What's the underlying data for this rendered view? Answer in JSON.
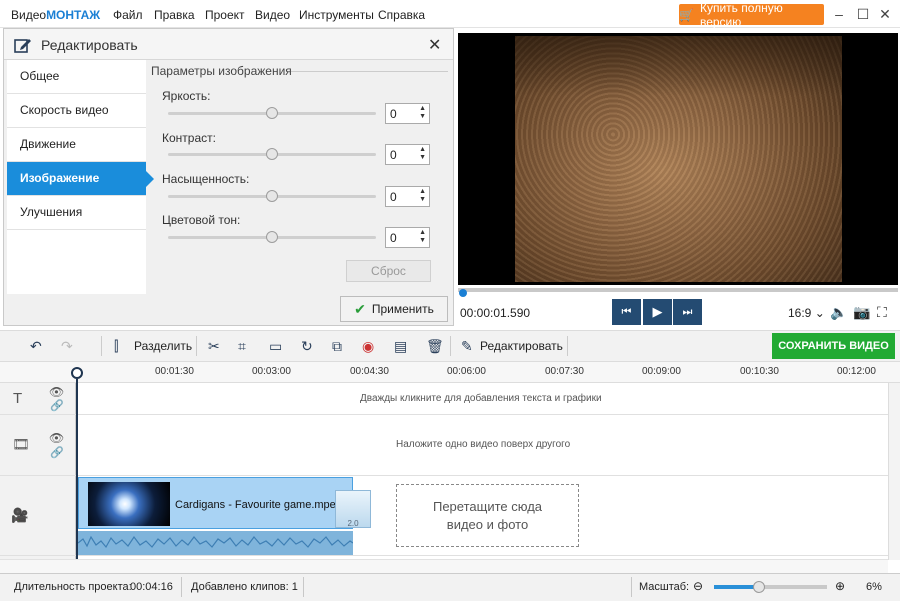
{
  "app": {
    "title_prefix": "Видео",
    "title_brand": "МОНТАЖ"
  },
  "menu": [
    "Файл",
    "Правка",
    "Проект",
    "Видео",
    "Инструменты",
    "Справка"
  ],
  "buy_button": "Купить полную версию",
  "window_controls": {
    "minimize": "–",
    "maximize": "☐",
    "close": "✕"
  },
  "edit_panel": {
    "title": "Редактировать",
    "nav": [
      "Общее",
      "Скорость видео",
      "Движение",
      "Изображение",
      "Улучшения"
    ],
    "active_nav": "Изображение",
    "params_title": "Параметры изображения",
    "params": [
      {
        "label": "Яркость:",
        "value": "0",
        "level": 0.5
      },
      {
        "label": "Контраст:",
        "value": "0",
        "level": 0.5
      },
      {
        "label": "Насыщенность:",
        "value": "0",
        "level": 0.5
      },
      {
        "label": "Цветовой тон:",
        "value": "0",
        "level": 0.5
      }
    ],
    "reset": "Сброс",
    "apply": "Применить"
  },
  "preview": {
    "timecode": "00:00:01.590",
    "aspect_ratio": "16:9 ⌄"
  },
  "toolbar": {
    "split": "Разделить",
    "edit": "Редактировать",
    "save": "СОХРАНИТЬ ВИДЕО"
  },
  "ruler": [
    "00:01:30",
    "00:03:00",
    "00:04:30",
    "00:06:00",
    "00:07:30",
    "00:09:00",
    "00:10:30",
    "00:12:00"
  ],
  "timeline": {
    "text_track_hint": "Дважды кликните для добавления текста и графики",
    "overlay_track_hint": "Наложите одно видео поверх другого",
    "clip_title": "Cardigans - Favourite game.mpeg",
    "transition_label": "2.0",
    "drop_zone": "Перетащите сюда\nвидео и фото"
  },
  "status": {
    "duration_label": "Длительность проекта:",
    "duration": "00:04:16",
    "clips": "Добавлено клипов: 1",
    "zoom_label": "Масштаб:",
    "zoom_percent": "6%",
    "zoom_level": 0.4
  }
}
